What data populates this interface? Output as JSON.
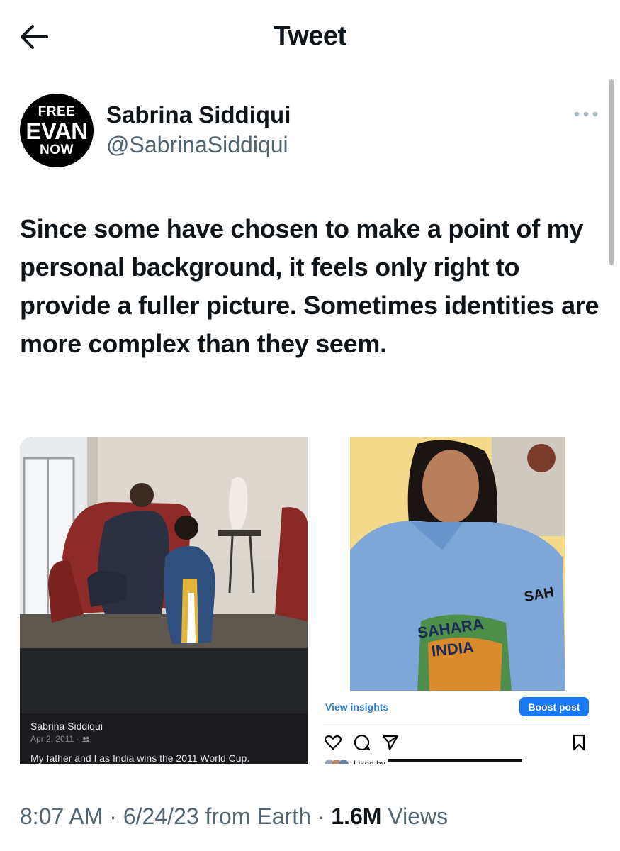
{
  "header": {
    "title": "Tweet",
    "back_icon": "arrow-left-icon"
  },
  "author": {
    "avatar_lines": [
      "FREE",
      "EVAN",
      "NOW"
    ],
    "display_name": "Sabrina Siddiqui",
    "handle": "@SabrinaSiddiqui"
  },
  "tweet": {
    "text": "Since some have chosen to make a point of my personal background, it feels only right to provide a fuller picture. Sometimes identities are more complex than they seem."
  },
  "media": {
    "facebook_post": {
      "name": "Sabrina Siddiqui",
      "date": "Apr 2, 2011 ·",
      "caption": "My father and I as India wins the 2011 World Cup."
    },
    "instagram_post": {
      "view_insights": "View insights",
      "boost_post": "Boost post",
      "jersey_text": "SAH",
      "jersey_front": "SAHARA",
      "jersey_india": "INDIA",
      "liked_by": "Liked by"
    }
  },
  "meta": {
    "time": "8:07 AM",
    "separator": " · ",
    "date": "6/24/23",
    "source": " from Earth",
    "separator2": " · ",
    "views_count": "1.6M",
    "views_label": " Views"
  },
  "colors": {
    "secondary_text": "#536471",
    "primary_text": "#0f1419",
    "boost_blue": "#1877f2"
  }
}
